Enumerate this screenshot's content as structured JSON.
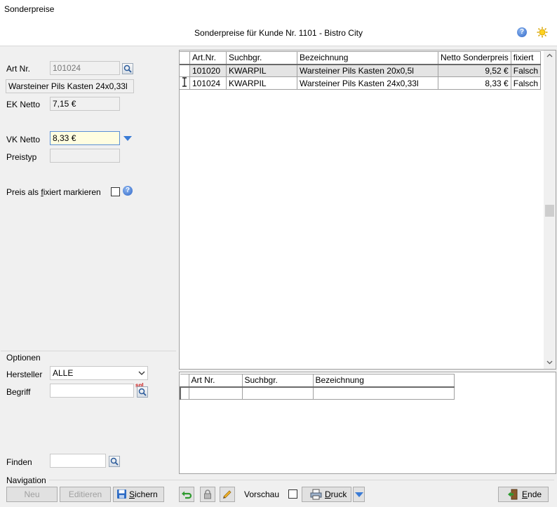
{
  "window": {
    "title": "Sonderpreise"
  },
  "header": {
    "title": "Sonderpreise für Kunde Nr. 1101 - Bistro City"
  },
  "form": {
    "art_nr_label": "Art Nr.",
    "art_nr_value": "101024",
    "description_value": "Warsteiner Pils Kasten 24x0,33l",
    "ek_netto_label": "EK Netto",
    "ek_netto_value": "7,15 €",
    "vk_netto_label": "VK Netto",
    "vk_netto_value": "8,33 €",
    "preistyp_label": "Preistyp",
    "preistyp_value": "",
    "fixiert_label_before": "Preis als ",
    "fixiert_label_accel": "f",
    "fixiert_label_after": "ixiert markieren"
  },
  "options": {
    "title": "Optionen",
    "hersteller_label": "Hersteller",
    "hersteller_value": "ALLE",
    "begriff_label": "Begriff",
    "begriff_value": "",
    "sql_badge": "sql",
    "finden_label": "Finden",
    "finden_value": ""
  },
  "main_grid": {
    "columns": [
      "Art.Nr.",
      "Suchbgr.",
      "Bezeichnung",
      "Netto Sonderpreis",
      "fixiert"
    ],
    "rows": [
      [
        "101020",
        "KWARPIL",
        "Warsteiner Pils Kasten 20x0,5l",
        "9,52 €",
        "Falsch"
      ],
      [
        "101024",
        "KWARPIL",
        "Warsteiner Pils Kasten 24x0,33l",
        "8,33 €",
        "Falsch"
      ]
    ]
  },
  "lower_grid": {
    "columns": [
      "Art Nr.",
      "Suchbgr.",
      "Bezeichnung"
    ]
  },
  "navigation": {
    "title": "Navigation",
    "neu": "Neu",
    "editieren": "Editieren",
    "sichern_accel": "S",
    "sichern_rest": "ichern",
    "vorschau": "Vorschau",
    "druck_accel": "D",
    "druck_rest": "ruck",
    "ende_accel": "E",
    "ende_rest": "nde"
  },
  "icons": {
    "help": "help-icon",
    "settings": "sun-icon",
    "search": "search-icon",
    "dropdown": "triangle-down-icon",
    "save": "floppy-disk-icon",
    "undo": "undo-arrow-icon",
    "lock": "lock-icon",
    "edit": "pencil-icon",
    "print": "printer-icon",
    "exit": "exit-door-icon"
  },
  "colors": {
    "accent": "#3a7bd5",
    "active_field": "#fffde0",
    "selected_row": "#e4e4e4"
  }
}
